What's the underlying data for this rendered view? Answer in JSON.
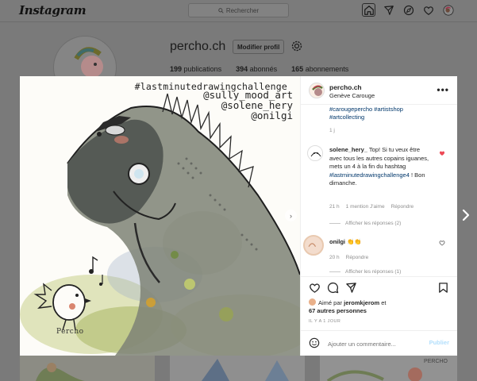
{
  "app": {
    "logo": "Instagram"
  },
  "search": {
    "placeholder": "Rechercher",
    "icon": "search-icon"
  },
  "nav": {
    "icons": [
      "home-icon",
      "direct-icon",
      "explore-icon",
      "heart-icon",
      "profile-avatar"
    ]
  },
  "profile": {
    "username": "percho.ch",
    "edit_label": "Modifier profil",
    "stats": {
      "posts_count": "199",
      "posts_label": "publications",
      "followers_count": "394",
      "followers_label": "abonnés",
      "following_count": "165",
      "following_label": "abonnements"
    }
  },
  "background_thumbs": {
    "third_mark": "PERCHO"
  },
  "post": {
    "image_text": {
      "line1": "#lastminutedrawingchallenge",
      "line2": "@sully_mood_art",
      "line3": "@solene_hery",
      "line4": "@onilgi",
      "signature": "Percho"
    },
    "header": {
      "username": "percho.ch",
      "location": "Genève Carouge",
      "more": "•••"
    },
    "caption": {
      "tags_line1": "#carougepercho #artistshop",
      "tags_line2": "#artcollecting",
      "time": "1 j"
    },
    "comments": [
      {
        "username": "solene_hery_",
        "text_before": " Top! Si tu veux être avec tous les autres copains iguanes, mets un 4 à la fin du hashtag ",
        "tag": "#lastminutedrawingchallenge4",
        "text_after": " ! Bon dimanche.",
        "time": "21 h",
        "likes": "1 mention J'aime",
        "reply_label": "Répondre",
        "show_replies": "Afficher les réponses (2)",
        "liked": true
      },
      {
        "username": "onilgi",
        "text": " 👏👏",
        "time": "20 h",
        "reply_label": "Répondre",
        "show_replies": "Afficher les réponses (1)",
        "liked": false
      }
    ],
    "likes": {
      "prefix": "Aimé par ",
      "liker": "jeromkjerom",
      "middle": " et",
      "others": "67 autres personnes"
    },
    "posted_ago": "IL Y A 1 JOUR",
    "add_comment": {
      "placeholder": "Ajouter un commentaire...",
      "post_label": "Publier"
    }
  },
  "colors": {
    "link": "#00376b",
    "like_red": "#ed4956",
    "publish_disabled": "#b2dffc",
    "secondary_text": "#8e8e8e"
  }
}
